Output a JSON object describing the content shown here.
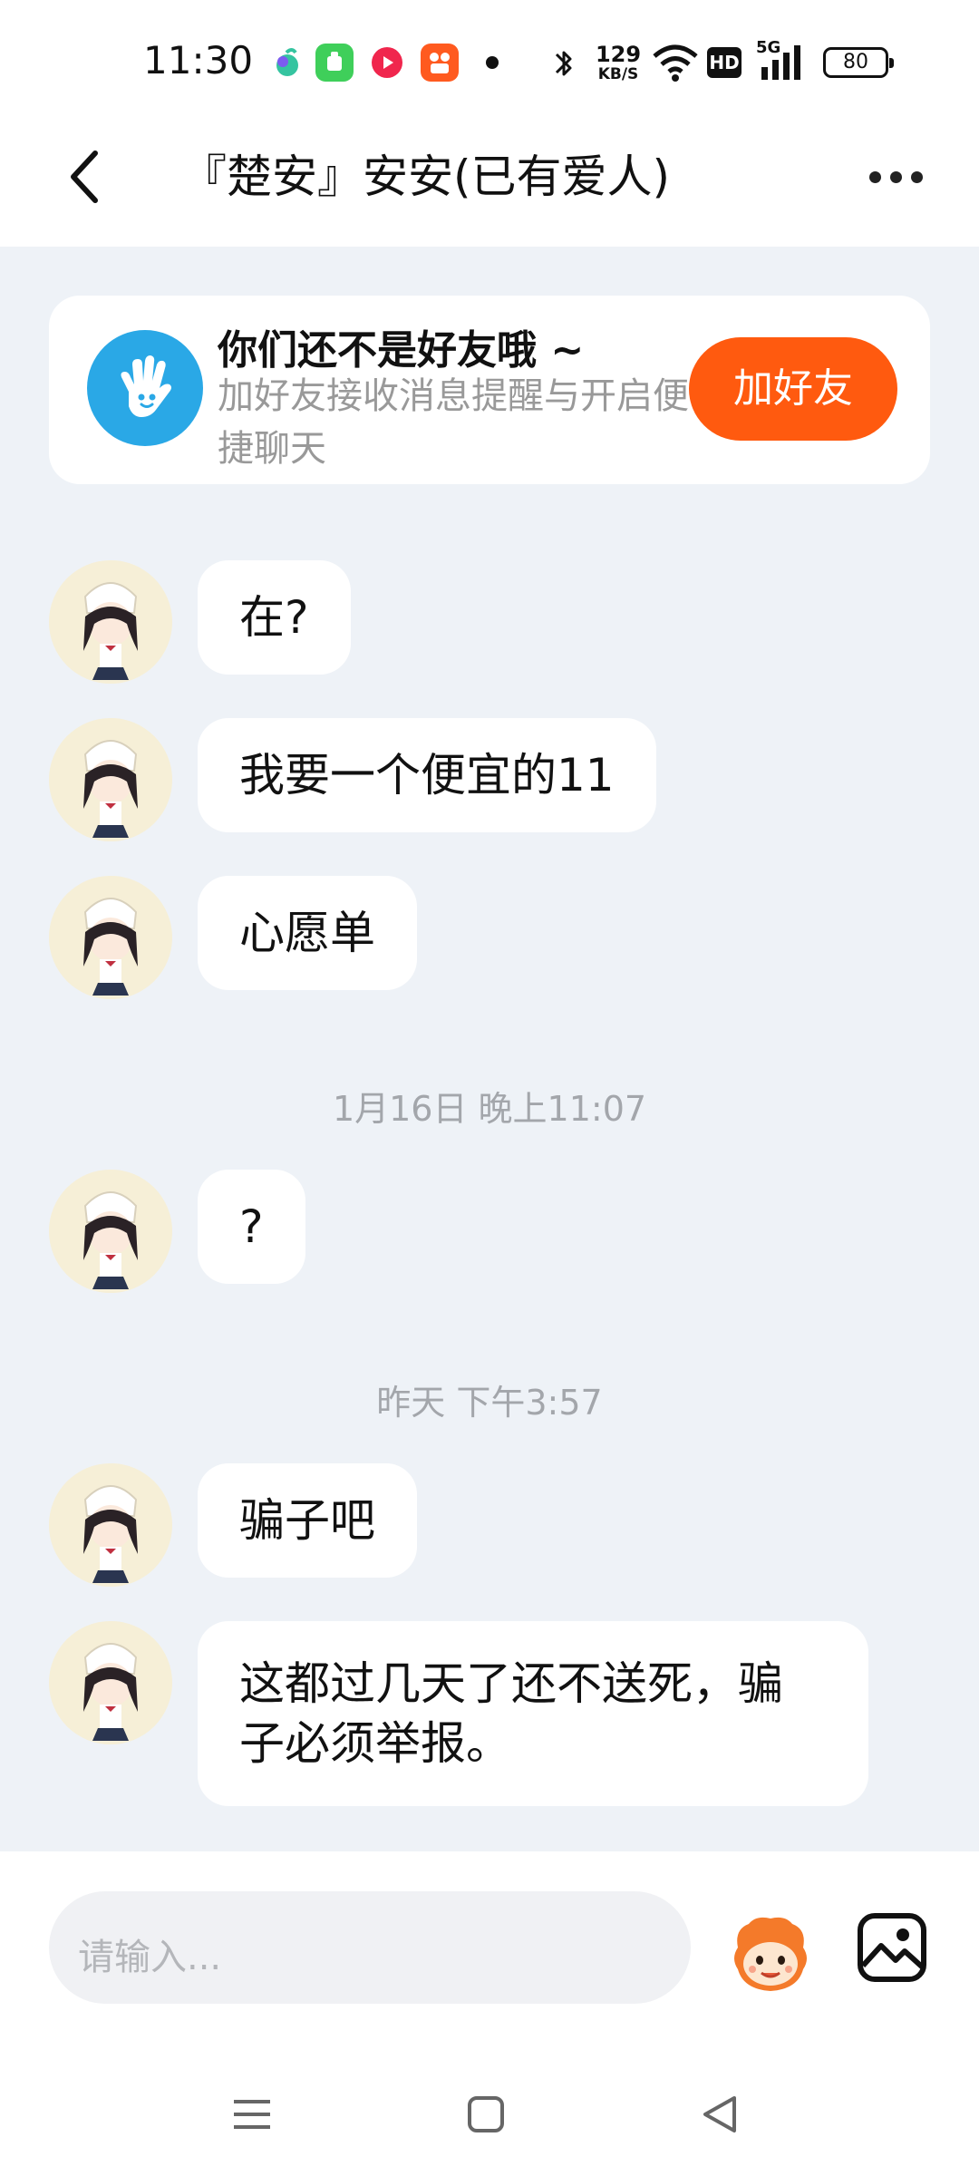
{
  "status_bar": {
    "time": "11:30",
    "net_speed_value": "129",
    "net_speed_unit": "KB/S",
    "hd_label": "HD",
    "network_label": "5G",
    "battery": "80"
  },
  "header": {
    "title": "『楚安』安安(已有爱人)"
  },
  "friend_banner": {
    "title": "你们还不是好友哦 ~",
    "subtitle": "加好友接收消息提醒与开启便捷聊天",
    "button": "加好友"
  },
  "messages": [
    {
      "text": "在?"
    },
    {
      "text": "我要一个便宜的11"
    },
    {
      "text": "心愿单"
    },
    {
      "timestamp": "1月16日 晚上11:07"
    },
    {
      "text": "?"
    },
    {
      "timestamp": "昨天 下午3:57"
    },
    {
      "text": "骗子吧"
    },
    {
      "text": "这都过几天了还不送死，骗子必须举报。"
    }
  ],
  "composer": {
    "placeholder": "请输入..."
  },
  "colors": {
    "accent": "#ff5a0f",
    "banner_icon": "#2aa8e6",
    "page_bg": "#eef2f7"
  }
}
